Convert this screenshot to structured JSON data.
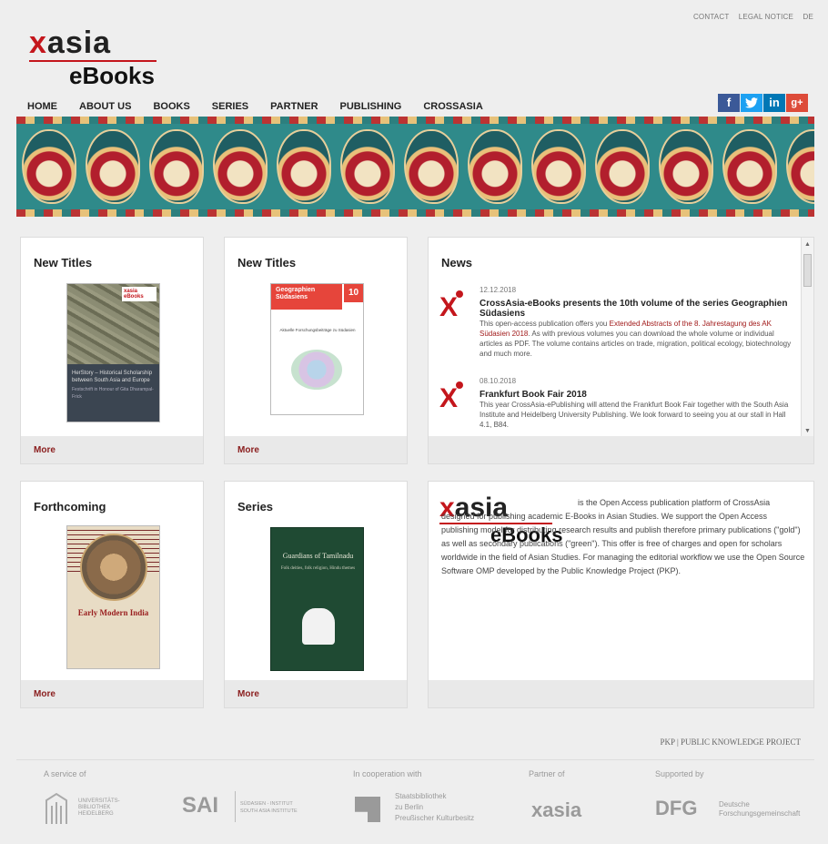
{
  "topbar": {
    "contact": "CONTACT",
    "legal": "LEGAL NOTICE",
    "lang": "DE"
  },
  "logo": {
    "x": "x",
    "asia": "asia",
    "ebooks": "eBooks"
  },
  "nav": [
    "HOME",
    "ABOUT US",
    "BOOKS",
    "SERIES",
    "PARTNER",
    "PUBLISHING",
    "CROSSASIA"
  ],
  "social": [
    "f",
    "t",
    "in",
    "g+"
  ],
  "panels": {
    "new1": {
      "title": "New Titles",
      "more": "More",
      "cover": {
        "title": "HerStory – Historical Scholarship between South Asia and Europe",
        "sub": "Festschrift in Honour of Gita Dharampal-Frick",
        "badge": "xasia eBooks"
      }
    },
    "new2": {
      "title": "New Titles",
      "more": "More",
      "cover": {
        "title": "Geographien Südasiens",
        "num": "10",
        "sub": "Aktuelle Forschungsbeiträge zu Südasien"
      }
    },
    "news": {
      "title": "News",
      "items": [
        {
          "date": "12.12.2018",
          "headline": "CrossAsia-eBooks presents the 10th volume of the series Geographien Südasiens",
          "pre": "This open-access publication offers you ",
          "link": "Extended Abstracts of the 8. Jahrestagung des AK Südasien 2018",
          "post": ". As with previous volumes you can download the whole volume or individual articles as PDF. The volume contains articles on trade, migration, political ecology, biotechnology and much more."
        },
        {
          "date": "08.10.2018",
          "headline": "Frankfurt Book Fair 2018",
          "pre": "This year CrossAsia-ePublishing will attend the Frankfurt Book Fair together with the South Asia Institute and Heidelberg University Publishing. We look forward to seeing you at our stall in Hall 4.1, B84.",
          "link": "",
          "post": ""
        }
      ]
    },
    "forthcoming": {
      "title": "Forthcoming",
      "more": "More",
      "cover": {
        "title": "Early Modern India"
      }
    },
    "series": {
      "title": "Series",
      "more": "More",
      "cover": {
        "title": "Guardians of Tamilnadu",
        "sub": "Folk deities, folk religion, Hindu themes"
      }
    },
    "about": {
      "text": "is the Open Access publication platform of CrossAsia designed for publishing academic E-Books in Asian Studies. We support the Open Access publishing model for distributing research results and publish therefore primary publications (\"gold\") as well as secondary publications (\"green\"). This offer is free of charges and open for scholars worldwide in the field of Asian Studies. For managing the editorial workflow we use the Open Source Software OMP developed by the Public Knowledge Project (PKP)."
    }
  },
  "pkp": "PKP | PUBLIC KNOWLEDGE PROJECT",
  "footer": {
    "labels": [
      "A service of",
      "In cooperation with",
      "Partner of",
      "Supported by"
    ],
    "ub": [
      "UNIVERSITÄTS-",
      "BIBLIOTHEK",
      "HEIDELBERG"
    ],
    "sai": {
      "abbr": "SAI",
      "l1": "SÜDASIEN - INSTITUT",
      "l2": "SOUTH ASIA INSTITUTE"
    },
    "sbb": [
      "Staatsbibliothek",
      "zu Berlin",
      "Preußischer Kulturbesitz"
    ],
    "xasia": "xasia",
    "dfg": {
      "abbr": "DFG",
      "l1": "Deutsche",
      "l2": "Forschungsgemeinschaft"
    }
  }
}
